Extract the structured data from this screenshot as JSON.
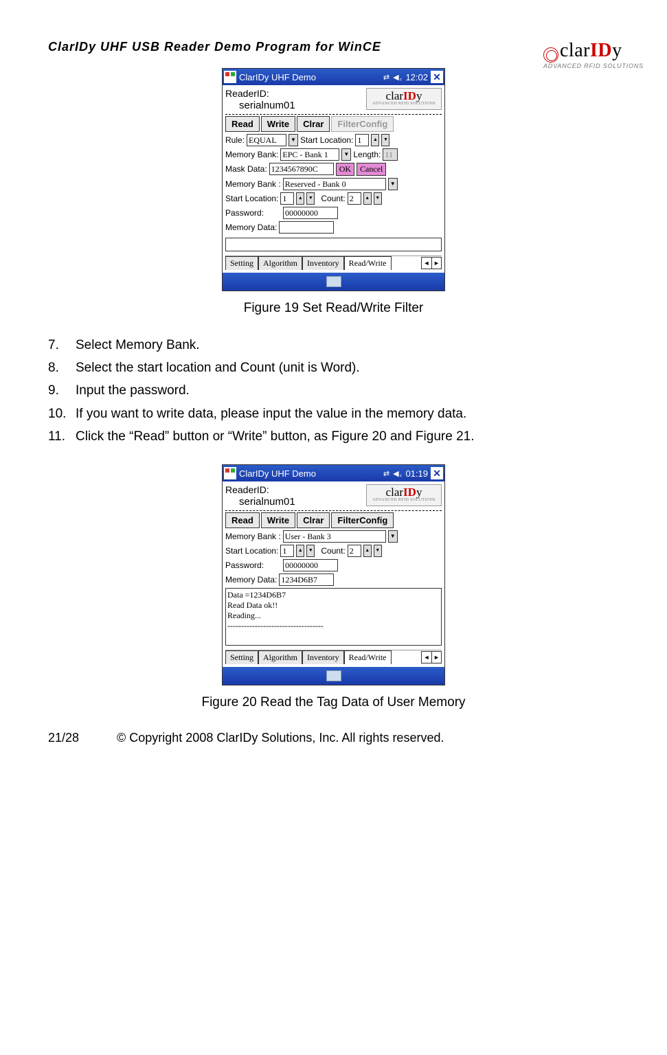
{
  "doc_title": "ClarIDy  UHF  USB  Reader  Demo  Program  for  WinCE",
  "brand": {
    "prefix": "clar",
    "mid": "ID",
    "suffix": "y",
    "sub": "ADVANCED RFID SOLUTIONS"
  },
  "fig19": {
    "title": "ClarIDy UHF Demo",
    "clock": "12:02",
    "reader_label": "ReaderID:",
    "serial": "serialnum01",
    "buttons": {
      "read": "Read",
      "write": "Write",
      "clear": "Clrar",
      "filter": "FilterConfig"
    },
    "rule_label": "Rule:",
    "rule_val": "EQUAL",
    "startloc_label": "Start Location:",
    "startloc_val": "1",
    "membank_label": "Memory Bank:",
    "membank_val": "EPC - Bank 1",
    "length_label": "Length:",
    "length_val": "11",
    "mask_label": "Mask Data:",
    "mask_val": "1234567890C",
    "ok": "OK",
    "cancel": "Cancel",
    "membank2_label": "Memory Bank :",
    "membank2_val": "Reserved - Bank 0",
    "startloc2_label": "Start Location:",
    "startloc2_val": "1",
    "count_label": "Count:",
    "count_val": "2",
    "password_label": "Password:",
    "password_val": "00000000",
    "memdata_label": "Memory Data:",
    "memdata_val": "",
    "tabs": {
      "setting": "Setting",
      "algorithm": "Algorithm",
      "inventory": "Inventory",
      "readwrite": "Read/Write"
    }
  },
  "caption19": "Figure 19 Set Read/Write Filter",
  "steps": [
    {
      "n": "7.",
      "t": "Select Memory Bank."
    },
    {
      "n": "8.",
      "t": "Select the start location and Count (unit is Word)."
    },
    {
      "n": "9.",
      "t": "Input the password."
    },
    {
      "n": "10.",
      "t": "If you want to write data, please input the value in the memory data."
    },
    {
      "n": "11.",
      "t": "Click the “Read” button or “Write” button, as Figure 20 and Figure 21."
    }
  ],
  "fig20": {
    "title": "ClarIDy UHF Demo",
    "clock": "01:19",
    "reader_label": "ReaderID:",
    "serial": "serialnum01",
    "buttons": {
      "read": "Read",
      "write": "Write",
      "clear": "Clrar",
      "filter": "FilterConfig"
    },
    "membank_label": "Memory Bank :",
    "membank_val": "User - Bank 3",
    "startloc_label": "Start Location:",
    "startloc_val": "1",
    "count_label": "Count:",
    "count_val": "2",
    "password_label": "Password:",
    "password_val": "00000000",
    "memdata_label": "Memory Data:",
    "memdata_val": "1234D6B7",
    "log": "Data =1234D6B7\nRead Data ok!!\nReading...\n-----------------------------------",
    "tabs": {
      "setting": "Setting",
      "algorithm": "Algorithm",
      "inventory": "Inventory",
      "readwrite": "Read/Write"
    }
  },
  "caption20": "Figure 20 Read the Tag Data of User Memory",
  "footer": {
    "page": "21/28",
    "copy": "© Copyright 2008 ClarIDy Solutions, Inc. All rights reserved."
  }
}
